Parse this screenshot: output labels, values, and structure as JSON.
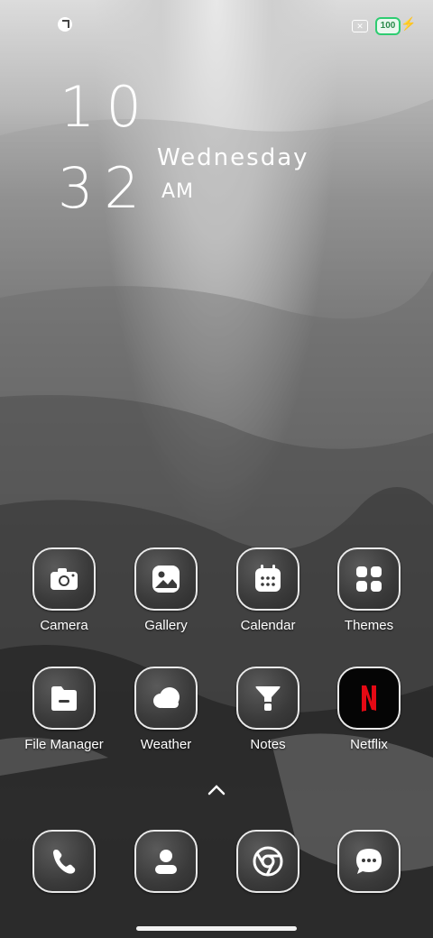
{
  "status_bar": {
    "battery": "100",
    "icons": [
      "app-notification-icon",
      "sim-off-icon",
      "battery-icon",
      "charging-icon"
    ]
  },
  "clock": {
    "hour": "10",
    "minute": "32",
    "day": "Wednesday",
    "ampm": "AM"
  },
  "apps": [
    {
      "label": "Camera",
      "icon": "camera-icon"
    },
    {
      "label": "Gallery",
      "icon": "gallery-icon"
    },
    {
      "label": "Calendar",
      "icon": "calendar-icon"
    },
    {
      "label": "Themes",
      "icon": "themes-icon"
    },
    {
      "label": "File Manager",
      "icon": "folder-icon"
    },
    {
      "label": "Weather",
      "icon": "weather-icon"
    },
    {
      "label": "Notes",
      "icon": "notes-icon"
    },
    {
      "label": "Netflix",
      "icon": "netflix-icon"
    }
  ],
  "dock": [
    {
      "icon": "phone-icon"
    },
    {
      "icon": "contacts-icon"
    },
    {
      "icon": "chrome-icon"
    },
    {
      "icon": "messages-icon"
    }
  ],
  "colors": {
    "battery_accent": "#2ecc71",
    "netflix_red": "#e50914"
  }
}
